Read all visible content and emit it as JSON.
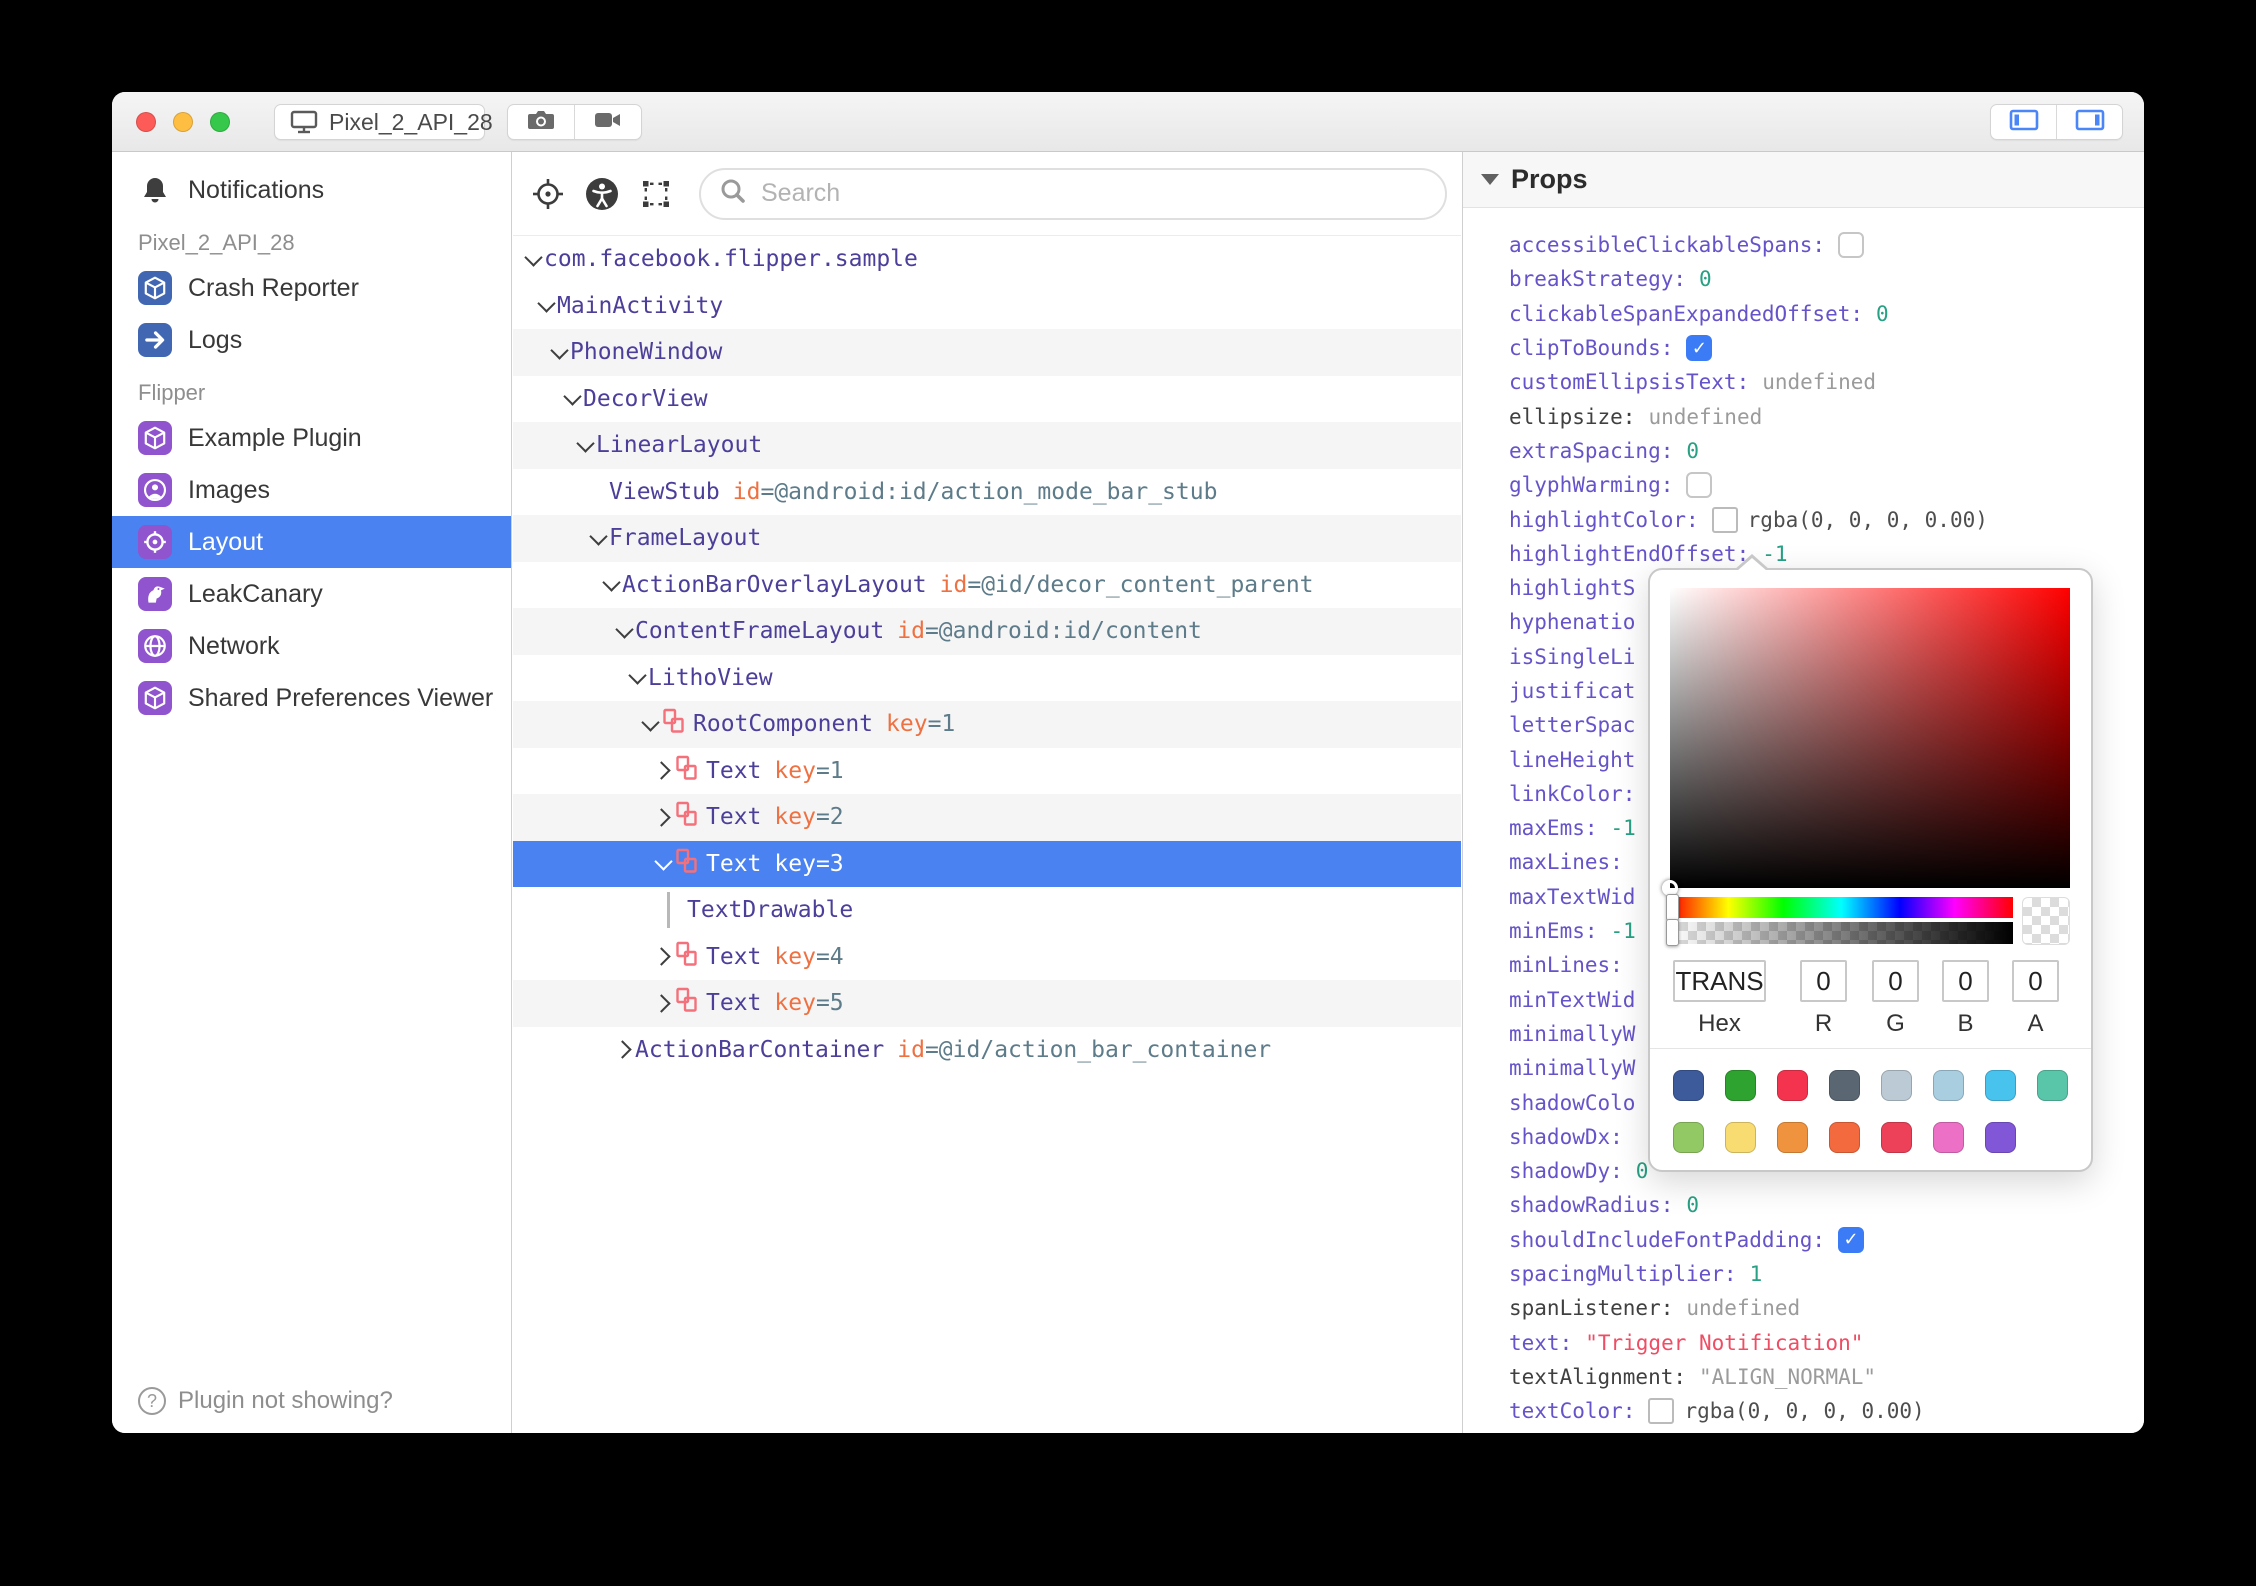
{
  "titlebar": {
    "device_tab_label": "Pixel_2_API_28"
  },
  "sidebar": {
    "top_item": {
      "icon": "bell-icon",
      "label": "Notifications"
    },
    "sections": [
      {
        "label": "Pixel_2_API_28",
        "icon_color": "#4267b2",
        "items": [
          {
            "icon": "cube",
            "label": "Crash Reporter"
          },
          {
            "icon": "arrow-right",
            "label": "Logs"
          }
        ]
      },
      {
        "label": "Flipper",
        "icon_color": "#8f54ce",
        "items": [
          {
            "icon": "cube",
            "label": "Example Plugin"
          },
          {
            "icon": "portrait",
            "label": "Images"
          },
          {
            "icon": "target",
            "label": "Layout",
            "selected": true
          },
          {
            "icon": "bird",
            "label": "LeakCanary"
          },
          {
            "icon": "globe",
            "label": "Network"
          },
          {
            "icon": "cube",
            "label": "Shared Preferences Viewer"
          }
        ]
      }
    ],
    "footer_label": "Plugin not showing?"
  },
  "toolbar": {
    "search_placeholder": "Search"
  },
  "tree": {
    "rows": [
      {
        "name": "com.facebook.flipper.sample",
        "depth": 0,
        "chevron": "down"
      },
      {
        "name": "MainActivity",
        "depth": 1,
        "chevron": "down"
      },
      {
        "name": "PhoneWindow",
        "depth": 2,
        "chevron": "down",
        "striped": true
      },
      {
        "name": "DecorView",
        "depth": 3,
        "chevron": "down"
      },
      {
        "name": "LinearLayout",
        "depth": 4,
        "chevron": "down",
        "striped": true
      },
      {
        "name": "ViewStub",
        "depth": 5,
        "attr_key": "id",
        "attr_value": "=@android:id/action_mode_bar_stub"
      },
      {
        "name": "FrameLayout",
        "depth": 5,
        "chevron": "down",
        "striped": true
      },
      {
        "name": "ActionBarOverlayLayout",
        "depth": 6,
        "chevron": "down",
        "attr_key": "id",
        "attr_value": "=@id/decor_content_parent"
      },
      {
        "name": "ContentFrameLayout",
        "depth": 7,
        "chevron": "down",
        "attr_key": "id",
        "attr_value": "=@android:id/content",
        "striped": true
      },
      {
        "name": "LithoView",
        "depth": 8,
        "chevron": "down"
      },
      {
        "name": "RootComponent",
        "depth": 9,
        "chevron": "down",
        "litho": true,
        "attr_key": "key",
        "attr_value": "=1",
        "striped": true
      },
      {
        "name": "Text",
        "depth": 10,
        "chevron": "right",
        "litho": true,
        "attr_key": "key",
        "attr_value": "=1"
      },
      {
        "name": "Text",
        "depth": 10,
        "chevron": "right",
        "litho": true,
        "attr_key": "key",
        "attr_value": "=2",
        "striped": true
      },
      {
        "name": "Text",
        "depth": 10,
        "chevron": "down",
        "litho": true,
        "attr_key": "key",
        "attr_value": "=3",
        "selected": true
      },
      {
        "name": "TextDrawable",
        "depth": 11,
        "guide": true
      },
      {
        "name": "Text",
        "depth": 10,
        "chevron": "right",
        "litho": true,
        "attr_key": "key",
        "attr_value": "=4"
      },
      {
        "name": "Text",
        "depth": 10,
        "chevron": "right",
        "litho": true,
        "attr_key": "key",
        "attr_value": "=5",
        "striped": true
      },
      {
        "name": "ActionBarContainer",
        "depth": 7,
        "chevron": "right",
        "attr_key": "id",
        "attr_value": "=@id/action_bar_container"
      }
    ]
  },
  "props": {
    "title": "Props",
    "rows": [
      {
        "key": "accessibleClickableSpans",
        "kind": "checkbox",
        "checked": false
      },
      {
        "key": "breakStrategy",
        "kind": "num",
        "value": "0"
      },
      {
        "key": "clickableSpanExpandedOffset",
        "kind": "num",
        "value": "0"
      },
      {
        "key": "clipToBounds",
        "kind": "checkbox",
        "checked": true
      },
      {
        "key": "customEllipsisText",
        "kind": "undef",
        "value": "undefined"
      },
      {
        "key": "ellipsize",
        "muted": true,
        "kind": "undef",
        "value": "undefined"
      },
      {
        "key": "extraSpacing",
        "kind": "num",
        "value": "0"
      },
      {
        "key": "glyphWarming",
        "kind": "checkbox",
        "checked": false
      },
      {
        "key": "highlightColor",
        "kind": "color",
        "value": "rgba(0, 0, 0, 0.00)"
      },
      {
        "key": "highlightEndOffset",
        "kind": "num",
        "value": "-1"
      },
      {
        "key": "highlightS",
        "truncated": true,
        "kind": "none"
      },
      {
        "key": "hyphenatio",
        "truncated": true,
        "kind": "none"
      },
      {
        "key": "isSingleLi",
        "truncated": true,
        "kind": "none"
      },
      {
        "key": "justificat",
        "truncated": true,
        "kind": "none"
      },
      {
        "key": "letterSpac",
        "truncated": true,
        "kind": "none"
      },
      {
        "key": "lineHeight",
        "truncated": true,
        "kind": "none"
      },
      {
        "key": "linkColor",
        "kind": "none"
      },
      {
        "key": "maxEms",
        "kind": "num",
        "value": "-1"
      },
      {
        "key": "maxLines",
        "kind": "none"
      },
      {
        "key": "maxTextWid",
        "truncated": true,
        "kind": "none"
      },
      {
        "key": "minEms",
        "kind": "num",
        "value": "-1"
      },
      {
        "key": "minLines",
        "kind": "none"
      },
      {
        "key": "minTextWid",
        "truncated": true,
        "kind": "none"
      },
      {
        "key": "minimallyW",
        "truncated": true,
        "kind": "none"
      },
      {
        "key": "minimallyW",
        "truncated": true,
        "kind": "none"
      },
      {
        "key": "shadowColo",
        "truncated": true,
        "kind": "none"
      },
      {
        "key": "shadowDx",
        "kind": "none"
      },
      {
        "key": "shadowDy",
        "kind": "num",
        "value": "0"
      },
      {
        "key": "shadowRadius",
        "kind": "num",
        "value": "0"
      },
      {
        "key": "shouldIncludeFontPadding",
        "kind": "checkbox",
        "checked": true
      },
      {
        "key": "spacingMultiplier",
        "kind": "num",
        "value": "1"
      },
      {
        "key": "spanListener",
        "muted": true,
        "kind": "undef",
        "value": "undefined"
      },
      {
        "key": "text",
        "kind": "str",
        "value": "\"Trigger Notification\""
      },
      {
        "key": "textAlignment",
        "muted": true,
        "kind": "undef",
        "value": "\"ALIGN_NORMAL\""
      },
      {
        "key": "textColor",
        "kind": "color",
        "value": "rgba(0, 0, 0, 0.00)"
      }
    ]
  },
  "picker": {
    "hex_value": "TRANS",
    "r_value": "0",
    "g_value": "0",
    "b_value": "0",
    "a_value": "0",
    "labels": {
      "hex": "Hex",
      "r": "R",
      "g": "G",
      "b": "B",
      "a": "A"
    },
    "swatches_row1": [
      "#3d5a9b",
      "#2ea32f",
      "#f4344f",
      "#5a6773",
      "#bbcad4",
      "#a8cee0",
      "#48c3ee",
      "#59c5a9"
    ],
    "swatches_row2": [
      "#93c964",
      "#f8dc72",
      "#f0933e",
      "#f46a3f",
      "#ec4159",
      "#ec70c5",
      "#8157d8"
    ]
  },
  "colors": {
    "selection_blue": "#4a82f2",
    "checkbox_blue": "#3b7cf6",
    "device_icon_blue": "#4267b2",
    "flipper_icon_purple": "#8f54ce",
    "litho_icon_pink": "#f4707b"
  }
}
